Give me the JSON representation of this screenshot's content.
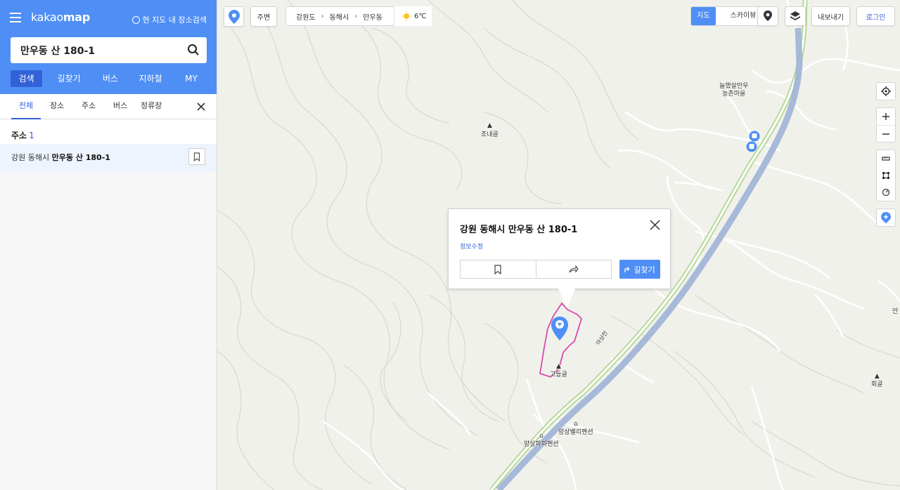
{
  "sidebar": {
    "logo_light": "kakao",
    "logo_bold": "map",
    "region_search_label": "현 지도 내 장소검색",
    "search_value": "만우동 산 180-1",
    "tabs": [
      {
        "label": "검색"
      },
      {
        "label": "길찾기"
      },
      {
        "label": "버스"
      },
      {
        "label": "지하철"
      },
      {
        "label": "MY"
      }
    ],
    "sub_tabs": [
      {
        "label": "전체"
      },
      {
        "label": "장소"
      },
      {
        "label": "주소"
      },
      {
        "label": "버스"
      },
      {
        "label": "정류장"
      }
    ],
    "result_header": "주소",
    "result_count": "1",
    "result_prefix": "강원 동해시 ",
    "result_bold": "만우동 산 180-1"
  },
  "map": {
    "nearby_label": "주변",
    "breadcrumb": [
      "강원도",
      "동해시",
      "만우동"
    ],
    "breadcrumb_sep": "›",
    "weather_temp": "6℃",
    "maptype_map": "지도",
    "maptype_sky": "스카이뷰",
    "export_label": "내보내기",
    "login_label": "로그인",
    "labels": {
      "village": "늘했살만우\n농촌마을",
      "jonaegol": "조내골",
      "godeunggol": "고등골",
      "hoegol": "회골",
      "valley_pension": "망상밸리펜션",
      "papa_pension": "망상파파펜션",
      "an": "안",
      "stream": "마상천"
    },
    "colors": {
      "accent": "#4f8ff5",
      "accent_dark": "#3262d7",
      "parcel": "#d84aa8",
      "river": "#8fa5c8",
      "river_bank": "#a9d18e"
    }
  },
  "popup": {
    "title": "강원 동해시 만우동 산 180-1",
    "edit_label": "정보수정",
    "route_label": "길찾기"
  }
}
